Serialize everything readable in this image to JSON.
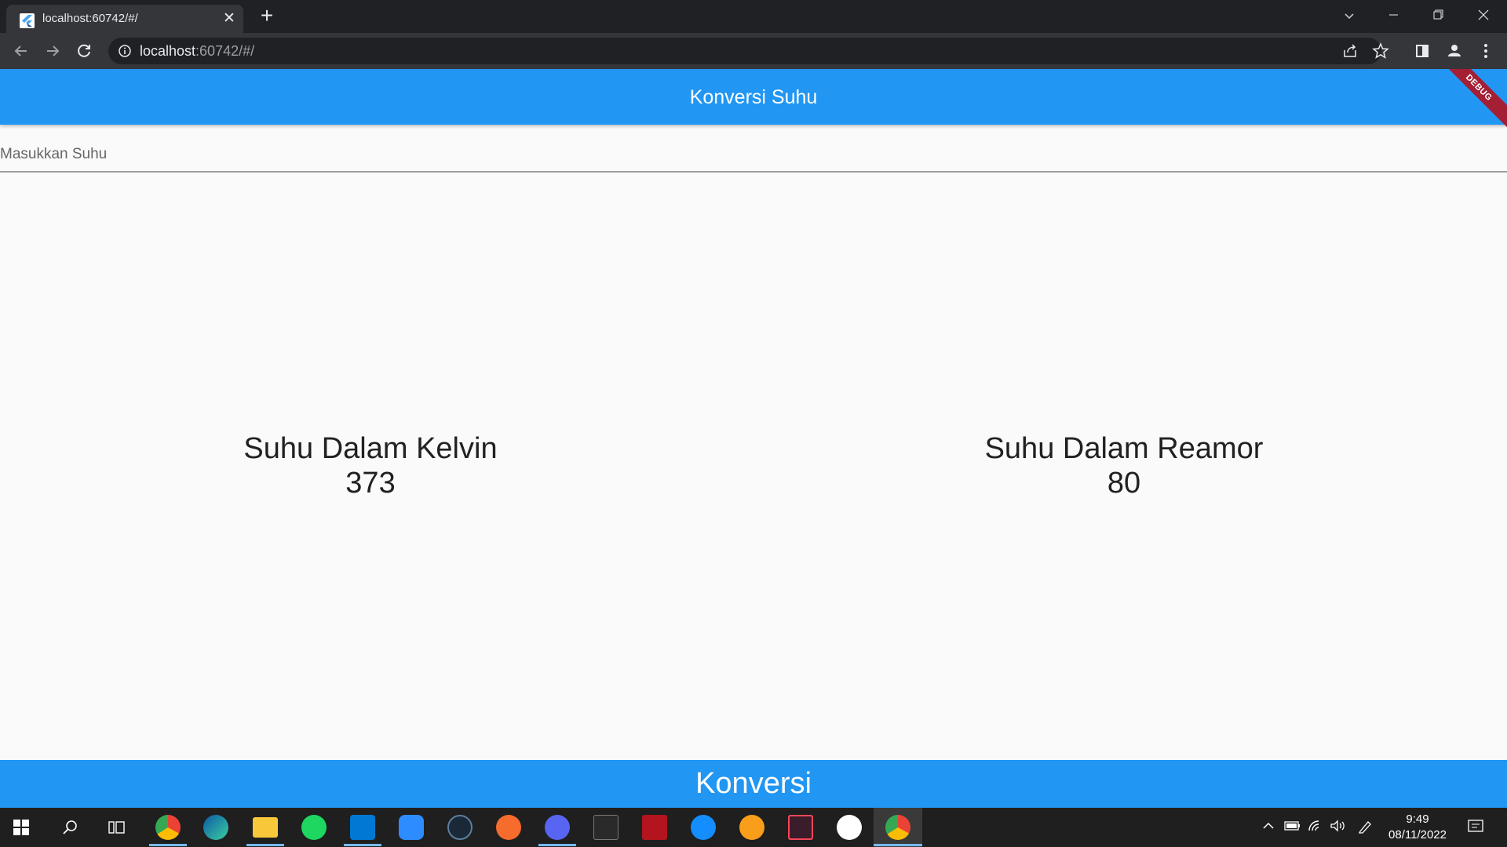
{
  "browser": {
    "tab_title": "localhost:60742/#/",
    "url_host": "localhost",
    "url_rest": ":60742/#/"
  },
  "app": {
    "title": "Konversi Suhu",
    "debug_label": "DEBUG",
    "input_placeholder": "Masukkan Suhu",
    "input_value": "",
    "kelvin_label": "Suhu Dalam Kelvin",
    "kelvin_value": "373",
    "reamur_label": "Suhu Dalam Reamor",
    "reamur_value": "80",
    "convert_label": "Konversi",
    "colors": {
      "primary": "#2196f3",
      "debug": "#a41e34"
    }
  },
  "taskbar": {
    "time": "9:49",
    "date": "08/11/2022",
    "pinned": [
      "chrome-profile-icon",
      "edge-icon",
      "file-explorer-icon",
      "spotify-icon",
      "vscode-icon",
      "zoom-icon",
      "steam-icon",
      "origin-icon",
      "discord-icon",
      "epic-games-icon",
      "redragon-icon",
      "battlenet-icon",
      "overwatch-icon",
      "valorant-icon",
      "wps-icon",
      "chrome-icon"
    ]
  }
}
